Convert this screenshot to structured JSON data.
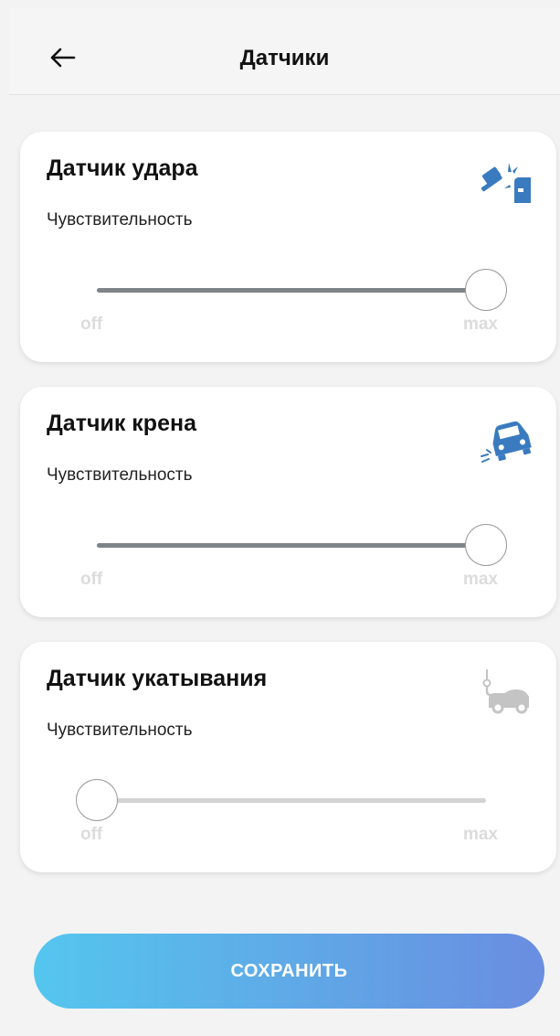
{
  "header": {
    "title": "Датчики",
    "back_icon": "arrow-left-icon"
  },
  "sensors": [
    {
      "title": "Датчик удара",
      "subtitle": "Чувствительность",
      "icon": "car-impact-icon",
      "icon_color": "#3a7bbf",
      "level": 1.0,
      "min_label": "off",
      "max_label": "max"
    },
    {
      "title": "Датчик крена",
      "subtitle": "Чувствительность",
      "icon": "car-tilt-icon",
      "icon_color": "#3a7bbf",
      "level": 1.0,
      "min_label": "off",
      "max_label": "max"
    },
    {
      "title": "Датчик укатывания",
      "subtitle": "Чувствительность",
      "icon": "car-tow-icon",
      "icon_color": "#c4c4c4",
      "level": 0.0,
      "min_label": "off",
      "max_label": "max"
    }
  ],
  "save_button": {
    "label": "СОХРАНИТЬ"
  },
  "colors": {
    "accent_start": "#54c6ee",
    "accent_end": "#6a8de0",
    "slider_active": "#7f8488",
    "slider_inactive": "#d3d3d3"
  }
}
